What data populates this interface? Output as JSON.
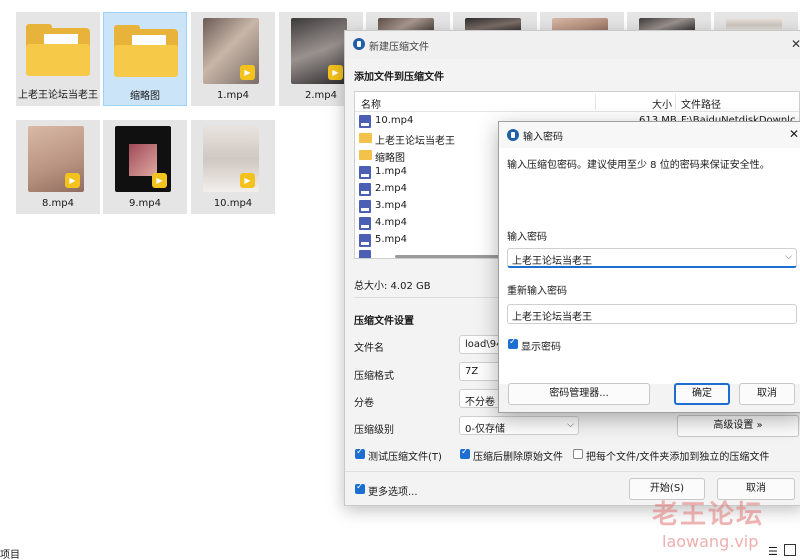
{
  "explorer": {
    "items": [
      {
        "name": "上老王论坛当老王",
        "type": "folder"
      },
      {
        "name": "缩略图",
        "type": "folder"
      },
      {
        "name": "1.mp4",
        "type": "video"
      },
      {
        "name": "2.mp4",
        "type": "video"
      },
      {
        "name": "8.mp4",
        "type": "video"
      },
      {
        "name": "9.mp4",
        "type": "video"
      },
      {
        "name": "10.mp4",
        "type": "video"
      }
    ],
    "video_badge": "Player",
    "status_left": "项目"
  },
  "compress_dialog": {
    "title": "新建压缩文件",
    "section_add": "添加文件到压缩文件",
    "columns": {
      "name": "名称",
      "size": "大小",
      "path": "文件路径"
    },
    "files": [
      {
        "name": "10.mp4",
        "type": "video",
        "size": "613 MB",
        "path": "F:\\BaiduNetdiskDownlc"
      },
      {
        "name": "上老王论坛当老王",
        "type": "folder"
      },
      {
        "name": "缩略图",
        "type": "folder"
      },
      {
        "name": "1.mp4",
        "type": "video"
      },
      {
        "name": "2.mp4",
        "type": "video"
      },
      {
        "name": "3.mp4",
        "type": "video"
      },
      {
        "name": "4.mp4",
        "type": "video"
      },
      {
        "name": "5.mp4",
        "type": "video"
      }
    ],
    "total_size": "总大小: 4.02 GB",
    "settings_title": "压缩文件设置",
    "filename_label": "文件名",
    "filename_value": "load\\94",
    "format_label": "压缩格式",
    "format_value": "7Z",
    "split_label": "分卷",
    "split_value": "不分卷",
    "level_label": "压缩级别",
    "level_value": "0-仅存储",
    "advanced_button": "高级设置 »",
    "test_checkbox": "测试压缩文件(T)",
    "delete_checkbox": "压缩后删除原始文件",
    "separate_checkbox": "把每个文件/文件夹添加到独立的压缩文件",
    "more_options": "更多选项...",
    "start_button": "开始(S)",
    "cancel_button": "取消"
  },
  "password_dialog": {
    "title": "输入密码",
    "hint": "输入压缩包密码。建议使用至少 8 位的密码来保证安全性。",
    "enter_label": "输入密码",
    "enter_value": "上老王论坛当老王",
    "reenter_label": "重新输入密码",
    "reenter_value": "上老王论坛当老王",
    "show_password": "显示密码",
    "manager_button": "密码管理器...",
    "ok_button": "确定",
    "cancel_button": "取消"
  },
  "watermark": {
    "cn": "老王论坛",
    "url": "laowang.vip"
  },
  "colors": {
    "accent": "#1c6ed1",
    "folder": "#f7c948",
    "badge": "#f3c21c"
  }
}
